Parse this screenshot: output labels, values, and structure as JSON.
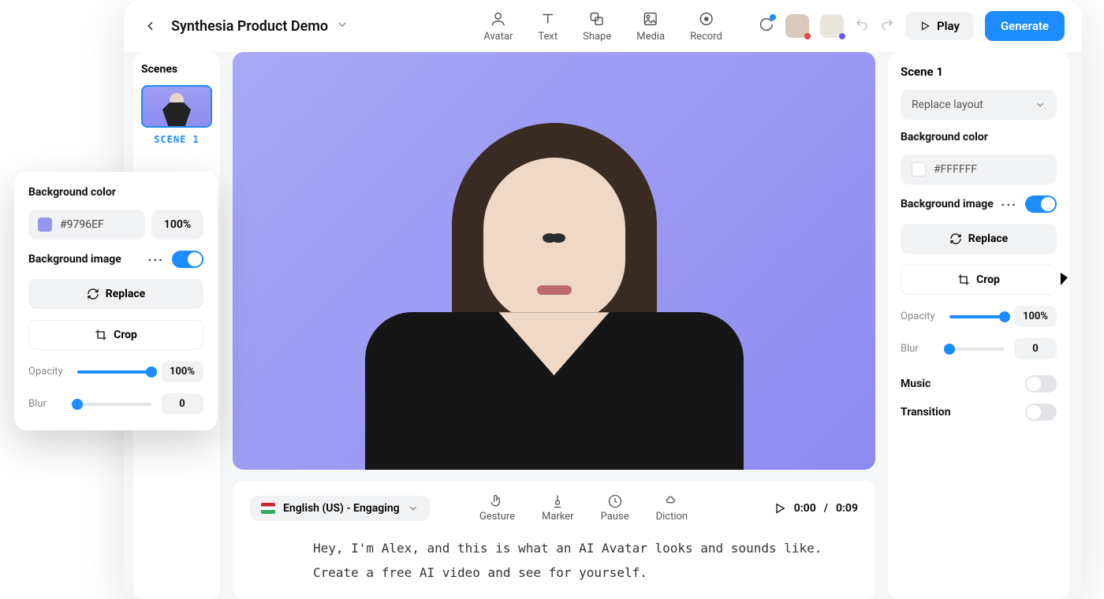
{
  "header": {
    "title": "Synthesia Product Demo",
    "tools": [
      {
        "id": "avatar",
        "label": "Avatar"
      },
      {
        "id": "text",
        "label": "Text"
      },
      {
        "id": "shape",
        "label": "Shape"
      },
      {
        "id": "media",
        "label": "Media"
      },
      {
        "id": "record",
        "label": "Record"
      }
    ],
    "play_label": "Play",
    "generate_label": "Generate"
  },
  "scenes": {
    "title": "Scenes",
    "items": [
      {
        "label": "SCENE 1"
      }
    ]
  },
  "script": {
    "language": "English (US) - Engaging",
    "tools": [
      {
        "id": "gesture",
        "label": "Gesture"
      },
      {
        "id": "marker",
        "label": "Marker"
      },
      {
        "id": "pause",
        "label": "Pause"
      },
      {
        "id": "diction",
        "label": "Diction"
      }
    ],
    "time_current": "0:00",
    "time_total": "0:09",
    "text": "Hey, I'm Alex, and this is what an AI Avatar looks and sounds like.\nCreate a free AI video and see for yourself."
  },
  "props": {
    "scene_title": "Scene 1",
    "replace_layout": "Replace layout",
    "bg_color_label": "Background color",
    "bg_color_value": "#FFFFFF",
    "bg_image_label": "Background image",
    "replace_label": "Replace",
    "crop_label": "Crop",
    "opacity_label": "Opacity",
    "opacity_value": "100%",
    "opacity_pct": 100,
    "blur_label": "Blur",
    "blur_value": "0",
    "blur_pct": 0,
    "music_label": "Music",
    "transition_label": "Transition"
  },
  "popover": {
    "bg_color_label": "Background color",
    "bg_color_value": "#9796EF",
    "bg_color_opacity": "100%",
    "bg_image_label": "Background image",
    "replace_label": "Replace",
    "crop_label": "Crop",
    "opacity_label": "Opacity",
    "opacity_value": "100%",
    "opacity_pct": 100,
    "blur_label": "Blur",
    "blur_value": "0",
    "blur_pct": 0
  },
  "colors": {
    "accent": "#1d8cff",
    "canvas": "#9796EF"
  }
}
